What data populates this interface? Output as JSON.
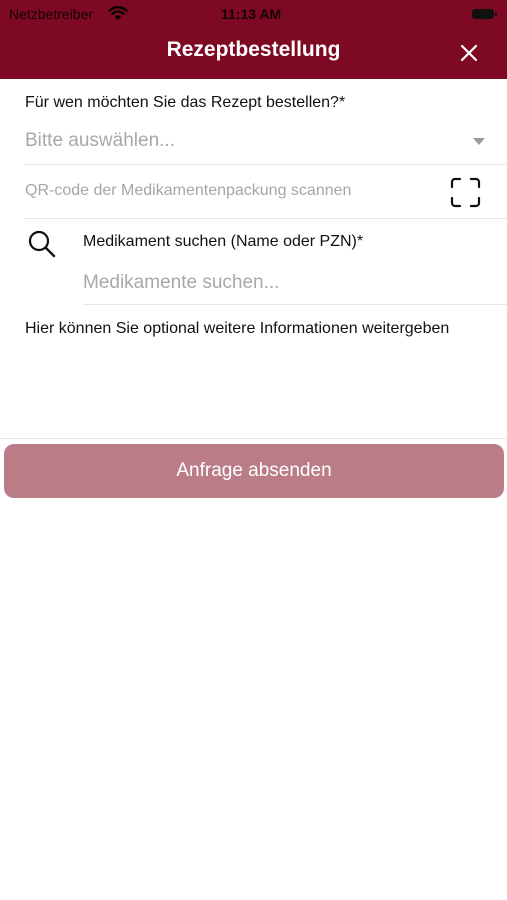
{
  "status_bar": {
    "carrier": "Netzbetreiber",
    "time": "11:13 AM"
  },
  "header": {
    "title": "Rezeptbestellung",
    "close_icon": "close-icon",
    "background_color": "#7d0a22"
  },
  "recipient": {
    "label": "Für wen möchten Sie das Rezept bestellen?*",
    "selected_value": "Bitte auswählen..."
  },
  "qr_scan": {
    "label": "QR-code der Medikamentenpackung scannen",
    "icon": "scan-frame-icon"
  },
  "medication": {
    "label": "Medikament suchen (Name oder PZN)*",
    "placeholder": "Medikamente suchen...",
    "icon": "search-icon"
  },
  "info": {
    "placeholder": "Hier können Sie optional weitere Informationen weitergeben"
  },
  "submit": {
    "label": "Anfrage absenden",
    "color": "#ba7d87"
  }
}
